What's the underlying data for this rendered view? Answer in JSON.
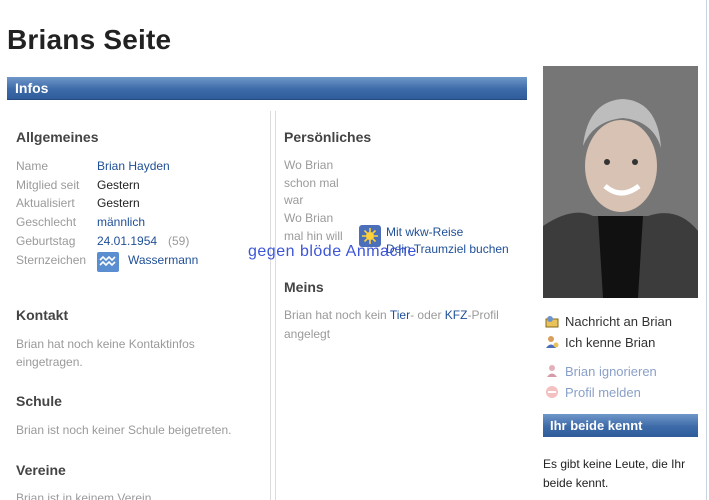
{
  "page": {
    "title": "Brians Seite"
  },
  "infos": {
    "title": "Infos"
  },
  "allgemeines": {
    "heading": "Allgemeines",
    "rows": [
      {
        "label": "Name",
        "value": "Brian Hayden"
      },
      {
        "label": "Mitglied seit",
        "value": "Gestern"
      },
      {
        "label": "Aktualisiert",
        "value": "Gestern"
      },
      {
        "label": "Geschlecht",
        "value": "männlich"
      },
      {
        "label": "Geburtstag",
        "value": "24.01.1954",
        "extra": "(59)"
      },
      {
        "label": "Sternzeichen",
        "value": "Wassermann"
      }
    ]
  },
  "kontakt": {
    "heading": "Kontakt",
    "text_line1": "Brian hat noch keine Kontaktinfos",
    "text_line2": "eingetragen."
  },
  "schule": {
    "heading": "Schule",
    "text": "Brian ist noch keiner Schule beigetreten."
  },
  "vereine": {
    "heading": "Vereine",
    "text": "Brian ist in keinem Verein"
  },
  "persoenliches": {
    "heading": "Persönliches",
    "q1_line1": "Wo Brian",
    "q1_line2": "schon mal",
    "q1_line3": "war",
    "q2_line1": "Wo Brian",
    "q2_line2": "mal hin will",
    "travel_link_line1": "Mit wkw-Reise",
    "travel_link_line2": "Dein Traumziel buchen"
  },
  "meins": {
    "heading": "Meins",
    "text_prefix": "Brian hat noch kein ",
    "link_tier": "Tier",
    "text_mid": "- oder ",
    "link_kfz": "KFZ",
    "text_suffix": "-Profil",
    "line2": "angelegt"
  },
  "overlay_text": "gegen blöde Anmache",
  "sidebar": {
    "actions": [
      {
        "label": "Nachricht an Brian",
        "icon": "message-icon",
        "color": "#1f4f96"
      },
      {
        "label": "Ich kenne Brian",
        "icon": "friend-icon",
        "color": "#1f4f96"
      },
      {
        "label": "Brian ignorieren",
        "icon": "ignore-icon",
        "color": "#8aa0c8"
      },
      {
        "label": "Profil melden",
        "icon": "report-icon",
        "color": "#8aa0c8"
      }
    ],
    "beide_kennt_title": "Ihr beide kennt",
    "beide_kennt_line1": "Es gibt keine Leute, die Ihr",
    "beide_kennt_line2": "beide kennt."
  },
  "colors": {
    "accent": "#3d6aa8",
    "link": "#1f4f96",
    "overlay": "#3d55d8"
  }
}
